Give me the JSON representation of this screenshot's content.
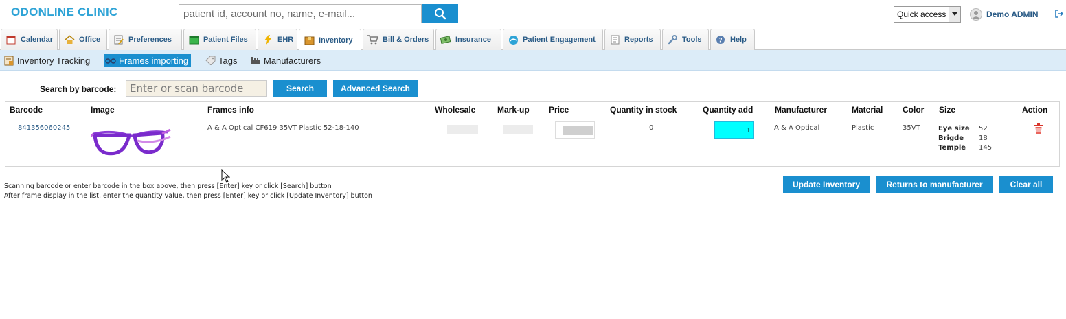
{
  "app": {
    "logo": "ODONLINE CLINIC",
    "search_placeholder": "patient id, account no, name, e-mail...",
    "quick_access": "Quick access",
    "user_name": "Demo ADMIN"
  },
  "tabs": [
    {
      "label": "Calendar",
      "icon": "calendar-icon"
    },
    {
      "label": "Office",
      "icon": "home-icon"
    },
    {
      "label": "Preferences",
      "icon": "preferences-icon"
    },
    {
      "label": "Patient Files",
      "icon": "folder-icon"
    },
    {
      "label": "EHR",
      "icon": "lightning-icon"
    },
    {
      "label": "Inventory",
      "icon": "box-icon"
    },
    {
      "label": "Bill & Orders",
      "icon": "cart-icon"
    },
    {
      "label": "Insurance",
      "icon": "money-icon"
    },
    {
      "label": "Patient Engagement",
      "icon": "wave-icon"
    },
    {
      "label": "Reports",
      "icon": "report-icon"
    },
    {
      "label": "Tools",
      "icon": "wrench-icon"
    },
    {
      "label": "Help",
      "icon": "help-icon"
    }
  ],
  "subnav": [
    {
      "label": "Inventory Tracking",
      "icon": "inventory-tracking-icon"
    },
    {
      "label": "Frames importing",
      "icon": "glasses-icon"
    },
    {
      "label": "Tags",
      "icon": "tag-icon"
    },
    {
      "label": "Manufacturers",
      "icon": "factory-icon"
    }
  ],
  "barcode_search": {
    "label": "Search by barcode:",
    "placeholder": "Enter or scan barcode",
    "search_button": "Search",
    "advanced_button": "Advanced Search"
  },
  "table": {
    "columns": [
      "Barcode",
      "Image",
      "Frames info",
      "Wholesale",
      "Mark-up",
      "Price",
      "Quantity in stock",
      "Quantity add",
      "Manufacturer",
      "Material",
      "Color",
      "Size",
      "Action"
    ],
    "rows": [
      {
        "barcode": "841356060245",
        "frames_info": "A & A Optical CF619 35VT Plastic 52-18-140",
        "quantity_in_stock": "0",
        "quantity_add": "1",
        "manufacturer": "A & A Optical",
        "material": "Plastic",
        "color": "35VT",
        "size": [
          {
            "label": "Eye size",
            "value": "52"
          },
          {
            "label": "Brigde",
            "value": "18"
          },
          {
            "label": "Temple",
            "value": "145"
          }
        ]
      }
    ]
  },
  "help_text": [
    "Scanning barcode or enter barcode in the box above, then press [Enter] key or click [Search] button",
    "After frame display in the list, enter the quantity value, then press [Enter] key or click [Update Inventory] button"
  ],
  "actions": {
    "update_inventory": "Update Inventory",
    "returns": "Returns to manufacturer",
    "clear_all": "Clear all"
  },
  "colors": {
    "brand": "#2ea3d6",
    "button": "#1a8fcf",
    "qty_highlight": "#00ffff",
    "subnav_bg": "#dcecf8"
  }
}
